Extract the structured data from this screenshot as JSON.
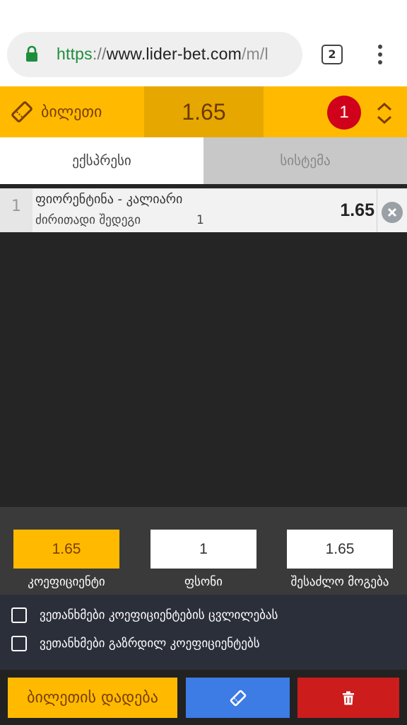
{
  "browser": {
    "url_scheme": "https",
    "url_separator": "://",
    "url_host": "www.lider-bet.com",
    "url_rest": "/m/l",
    "tab_count": "2",
    "icons": [
      "lock-icon",
      "menu-dots-icon"
    ]
  },
  "ticket": {
    "title": "ბილეთი",
    "total_odds": "1.65",
    "selection_count": "1",
    "icons": [
      "ticket-icon",
      "expand-collapse-icon"
    ]
  },
  "tabs": [
    {
      "label": "ექსპრესი",
      "active": true
    },
    {
      "label": "სისტემა",
      "active": false
    }
  ],
  "bets": [
    {
      "index": "1",
      "match": "ფიორენტინა - კალიარი",
      "market": "ძირითადი შედეგი",
      "outcome": "1",
      "odds": "1.65"
    }
  ],
  "stake": {
    "coefficient_value": "1.65",
    "coefficient_label": "კოეფიციენტი",
    "amount_value": "1",
    "amount_label": "ფსონი",
    "possible_win_value": "1.65",
    "possible_win_label": "შესაძლო მოგება"
  },
  "options": [
    {
      "label": "ვეთანხმები კოეფიციენტების ცვლილებას",
      "checked": false
    },
    {
      "label": "ვეთანხმები გაზრდილ კოეფიციენტებს",
      "checked": false
    }
  ],
  "actions": {
    "place_bet_label": "ბილეთის დადება",
    "icons": [
      "ticket-icon",
      "trash-icon"
    ]
  },
  "colors": {
    "accent": "#ffba00",
    "accent_dark": "#e6a800",
    "badge": "#d0021b",
    "blue_button": "#3d7be5",
    "red_button": "#cc1c1c"
  }
}
